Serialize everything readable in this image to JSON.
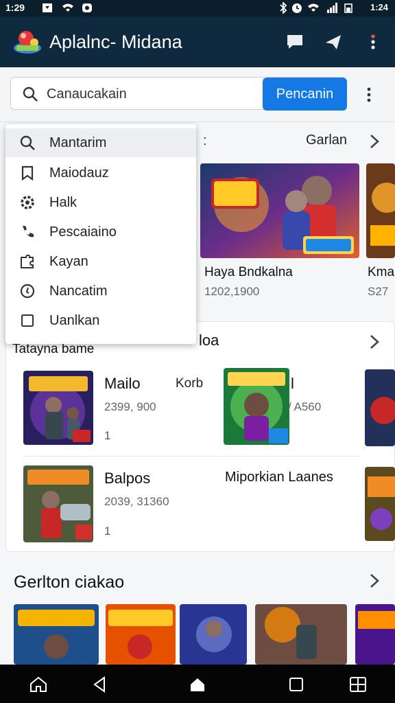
{
  "status": {
    "time": "1:29",
    "right_text": "1:24"
  },
  "app": {
    "title": "Aplalnc- Midana"
  },
  "search": {
    "value": "Canaucakain",
    "button_label": "Pencanin"
  },
  "menu": {
    "items": [
      {
        "label": "Mantarim",
        "icon": "search-icon"
      },
      {
        "label": "Maiodauz",
        "icon": "bookmark-icon"
      },
      {
        "label": "Halk",
        "icon": "settings-gear-icon"
      },
      {
        "label": "Pescaiaino",
        "icon": "phone-icon"
      },
      {
        "label": "Kayan",
        "icon": "puzzle-icon"
      },
      {
        "label": "Nancatim",
        "icon": "clock-icon"
      },
      {
        "label": "Uanlkan",
        "icon": "checkbox-icon"
      }
    ]
  },
  "section1": {
    "header": "Garlan",
    "featured": [
      {
        "title": "Haya Bndkalna",
        "sub": "1202,1900",
        "art": "NKUS BRAQS"
      },
      {
        "title": "Kma",
        "sub": "S27",
        "art": "KH"
      }
    ]
  },
  "section2": {
    "title": "Tatayna bame",
    "extra": "loa",
    "rows": [
      {
        "left": {
          "title": "Mailo",
          "sub": "2399, 900",
          "num": "1",
          "art": "KNAVINAX"
        },
        "mid": {
          "title": "Korb"
        },
        "right": {
          "title": "l",
          "sub": "/ A560",
          "art": "Kanne"
        }
      },
      {
        "left": {
          "title": "Balpos",
          "sub": "2039, 31360",
          "num": "1",
          "art": "SHUMRIS",
          "badge": "BA"
        },
        "mid": {
          "title": "Miporkian Laanes"
        }
      }
    ]
  },
  "section3": {
    "title": "Gerlton ciakao",
    "tiles": [
      "SAUZIME",
      "NARUIS",
      "",
      "CAMIA",
      "KAN"
    ]
  },
  "colors": {
    "appbar": "#0f2a3e",
    "accent": "#1479e4"
  }
}
